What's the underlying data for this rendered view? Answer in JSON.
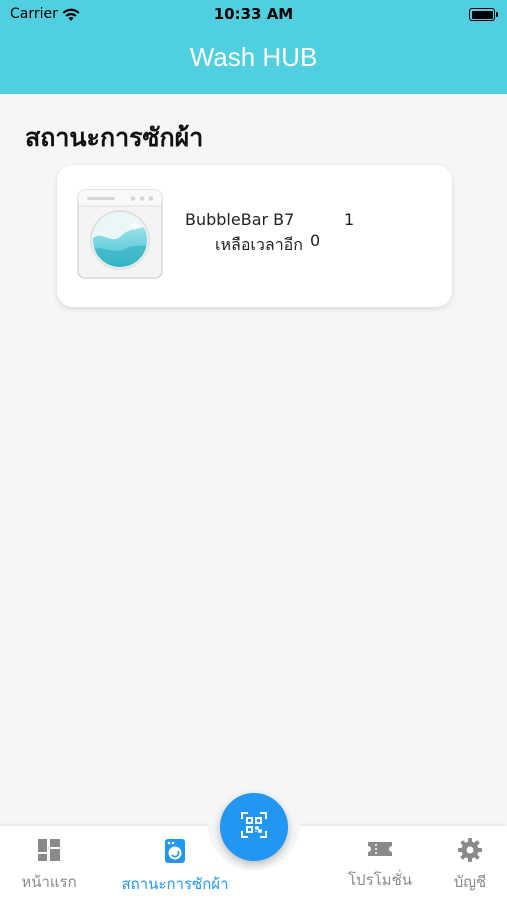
{
  "status_bar": {
    "carrier": "Carrier",
    "time": "10:33 AM"
  },
  "app": {
    "title": "Wash HUB"
  },
  "page": {
    "heading": "สถานะการซักผ้า"
  },
  "machine": {
    "name": "BubbleBar B7",
    "number": "1",
    "remaining_label": "เหลือเวลาอีก",
    "remaining_value": "0",
    "icon": "washing-machine-icon"
  },
  "tabs": [
    {
      "label": "หน้าแรก",
      "icon": "dashboard-icon",
      "active": false
    },
    {
      "label": "สถานะการซักผ้า",
      "icon": "washer-icon",
      "active": true
    },
    {
      "label": "โปรโมชั่น",
      "icon": "ticket-icon",
      "active": false
    },
    {
      "label": "บัญชี",
      "icon": "gear-icon",
      "active": false
    }
  ],
  "fab": {
    "icon": "qr-scan-icon"
  },
  "colors": {
    "header": "#4fcfdf",
    "accent": "#2196f3",
    "inactive": "#8a8a8a",
    "background": "#f6f6f6"
  }
}
